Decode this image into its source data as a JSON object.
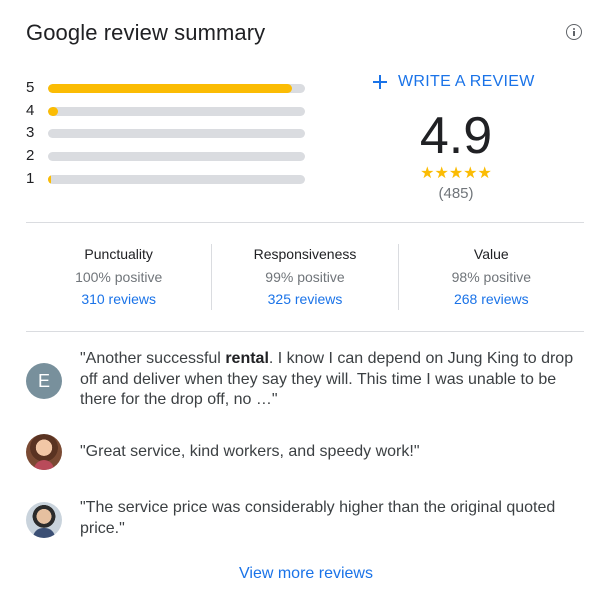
{
  "header": {
    "title": "Google review summary",
    "info_icon": "info-icon"
  },
  "distribution": [
    {
      "stars": "5",
      "fraction": 0.95
    },
    {
      "stars": "4",
      "fraction": 0.04
    },
    {
      "stars": "3",
      "fraction": 0.0
    },
    {
      "stars": "2",
      "fraction": 0.0
    },
    {
      "stars": "1",
      "fraction": 0.01
    }
  ],
  "summary": {
    "write_review": "WRITE A REVIEW",
    "write_icon": "plus-icon",
    "rating": "4.9",
    "stars": "★★★★★",
    "count": "(485)"
  },
  "attributes": [
    {
      "name": "Punctuality",
      "positive": "100% positive",
      "reviews": "310 reviews"
    },
    {
      "name": "Responsiveness",
      "positive": "99% positive",
      "reviews": "325 reviews"
    },
    {
      "name": "Value",
      "positive": "98% positive",
      "reviews": "268 reviews"
    }
  ],
  "snippets": [
    {
      "avatar": "E",
      "text_before": "\"Another successful ",
      "highlight": "rental",
      "text_after": ". I know I can depend on Jung King to drop off and deliver when they say they will. This time I was unable to be there for the drop off, no …\""
    },
    {
      "avatar": "",
      "text": "\"Great service, kind workers, and speedy work!\""
    },
    {
      "avatar": "",
      "text": "\"The service price was considerably higher than the original quoted price.\""
    }
  ],
  "footer": {
    "more_link": "View more reviews"
  },
  "colors": {
    "accent": "#1a73e8",
    "star": "#fbbc04",
    "track": "#dadce0"
  }
}
